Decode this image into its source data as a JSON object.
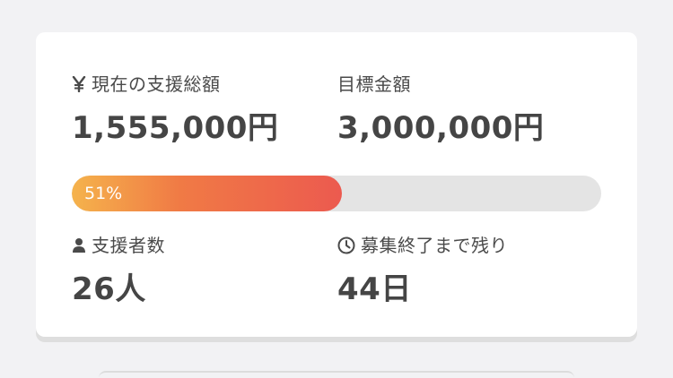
{
  "funding": {
    "current": {
      "icon": "yen-icon",
      "label": "現在の支援総額",
      "value": "1,555,000円"
    },
    "goal": {
      "label": "目標金額",
      "value": "3,000,000円"
    },
    "progress": {
      "percent": 51,
      "label": "51%",
      "fill_color_start": "#f5b34c",
      "fill_color_end": "#ec5a4f",
      "track_color": "#e4e4e4"
    },
    "backers": {
      "icon": "person-icon",
      "label": "支援者数",
      "value": "26人"
    },
    "remaining": {
      "icon": "clock-icon",
      "label": "募集終了まで残り",
      "value": "44日"
    }
  }
}
